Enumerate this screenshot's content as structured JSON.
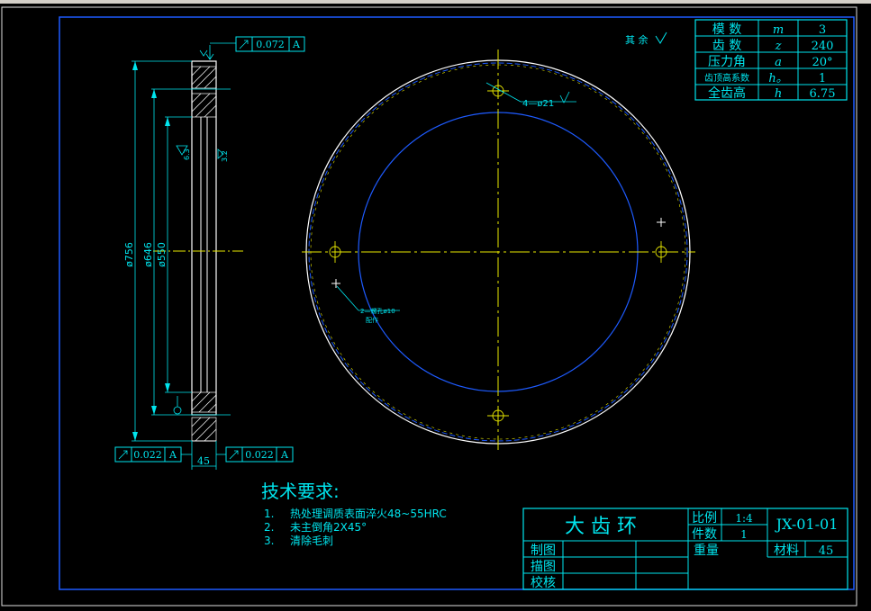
{
  "param_table": {
    "rows": [
      {
        "label": "模 数",
        "symbol": "m",
        "value": "3"
      },
      {
        "label": "齿 数",
        "symbol": "z",
        "value": "240"
      },
      {
        "label": "压力角",
        "symbol": "a",
        "value": "20°"
      },
      {
        "label": "齿顶高系数",
        "symbol": "h。",
        "value": "1"
      },
      {
        "label": "全齿高",
        "symbol": "h",
        "value": "6.75"
      }
    ]
  },
  "rest_note": "其 余",
  "section_view": {
    "tolerance_top": "0.072",
    "tolerance_bottom_left": "0.022",
    "tolerance_bottom_right": "0.022",
    "datum": "A",
    "dim_756": "ø756",
    "dim_646": "ø646",
    "dim_550": "ø550",
    "dim_width": "45",
    "roughness_mark_1": "6.3",
    "roughness_mark_2": "3.2"
  },
  "front_view": {
    "hole_note_top": "4—ø21",
    "hole_note_bottom_line1": "2—螺孔ø10",
    "hole_note_bottom_line2": "配作"
  },
  "tech_req": {
    "title": "技术要求:",
    "items": [
      {
        "num": "1.",
        "text": "热处理调质表面淬火48~55HRC"
      },
      {
        "num": "2.",
        "text": "未主倒角2X45°"
      },
      {
        "num": "3.",
        "text": "清除毛刺"
      }
    ]
  },
  "title_block": {
    "name": "大 齿 环",
    "scale_label": "比例",
    "scale_value": "1:4",
    "count_label": "件数",
    "count_value": "1",
    "weight_label": "重量",
    "drawing_no": "JX-01-01",
    "material_label": "材料",
    "material_value": "45",
    "drawn_by": "制图",
    "traced_by": "描图",
    "checked_by": "校核"
  },
  "colors": {
    "frame": "#1e5bff",
    "text": "#00e5ee",
    "centerline": "#e8e800",
    "ring": "#ffffff"
  }
}
